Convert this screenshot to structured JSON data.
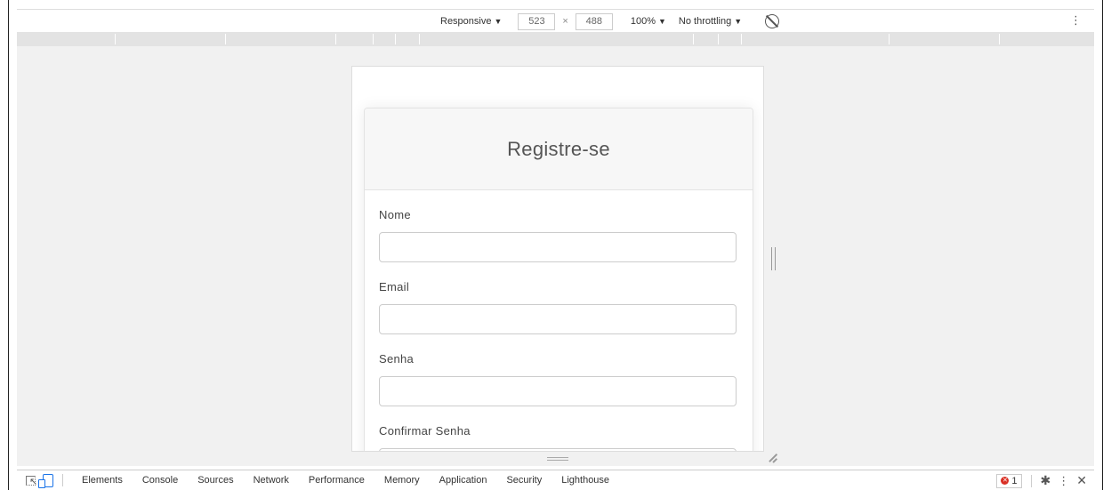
{
  "toolbar": {
    "device_mode": "Responsive",
    "width": "523",
    "times": "×",
    "height": "488",
    "zoom": "100%",
    "throttling": "No throttling",
    "arrow": "▼",
    "more": "⋮"
  },
  "form": {
    "title": "Registre-se",
    "fields": [
      {
        "label": "Nome"
      },
      {
        "label": "Email"
      },
      {
        "label": "Senha"
      },
      {
        "label": "Confirmar Senha"
      }
    ]
  },
  "devtools": {
    "tabs": [
      "Elements",
      "Console",
      "Sources",
      "Network",
      "Performance",
      "Memory",
      "Application",
      "Security",
      "Lighthouse"
    ],
    "error_count": "1",
    "more": "⋮",
    "close": "✕",
    "gear": "✱"
  },
  "icons": {
    "inspect": "inspect-element-icon",
    "device": "device-toolbar-icon",
    "rotate": "rotate-icon",
    "settings": "gear-icon"
  },
  "colors": {
    "accent": "#1a73e8",
    "error": "#d93025",
    "viewport_bg": "#f1f1f1",
    "card_header_bg": "#f7f7f7"
  }
}
